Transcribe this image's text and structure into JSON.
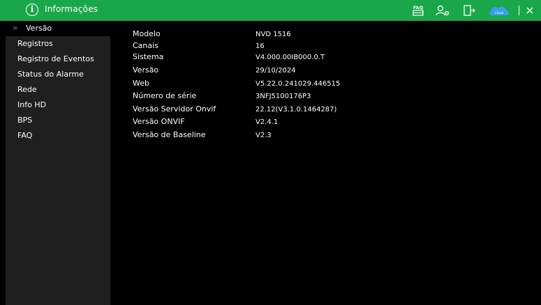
{
  "header": {
    "title": "Informações",
    "info_icon_glyph": "i",
    "cloud_label": "Cloud",
    "accent_color": "#19a74a"
  },
  "sidebar": {
    "items": [
      {
        "label": "Versão",
        "active": true
      },
      {
        "label": "Registros",
        "active": false
      },
      {
        "label": "Registro de Eventos",
        "active": false
      },
      {
        "label": "Status do Alarme",
        "active": false
      },
      {
        "label": "Rede",
        "active": false
      },
      {
        "label": "Info HD",
        "active": false
      },
      {
        "label": "BPS",
        "active": false
      },
      {
        "label": "FAQ",
        "active": false
      }
    ],
    "chevron": ">"
  },
  "info": {
    "rows": [
      {
        "label": "Modelo",
        "value": "NVD 1516"
      },
      {
        "label": "Canais",
        "value": "16"
      },
      {
        "label": "Sistema",
        "value": "V4.000.00IB000.0.T"
      },
      {
        "label": "Versão",
        "value": "29/10/2024"
      },
      {
        "label": "Web",
        "value": "V5.22.0.241029.446515"
      },
      {
        "label": "Número de série",
        "value": "3NFJ5100176P3"
      },
      {
        "label": "Versão Servidor Onvif",
        "value": "22.12(V3.1.0.1464287)"
      },
      {
        "label": "Versão ONVIF",
        "value": "V2.4.1"
      },
      {
        "label": "Versão de Baseline",
        "value": "V2.3"
      }
    ]
  },
  "icons": [
    "faq-icon",
    "user-settings-icon",
    "logout-icon",
    "cloud-icon",
    "close-icon"
  ]
}
